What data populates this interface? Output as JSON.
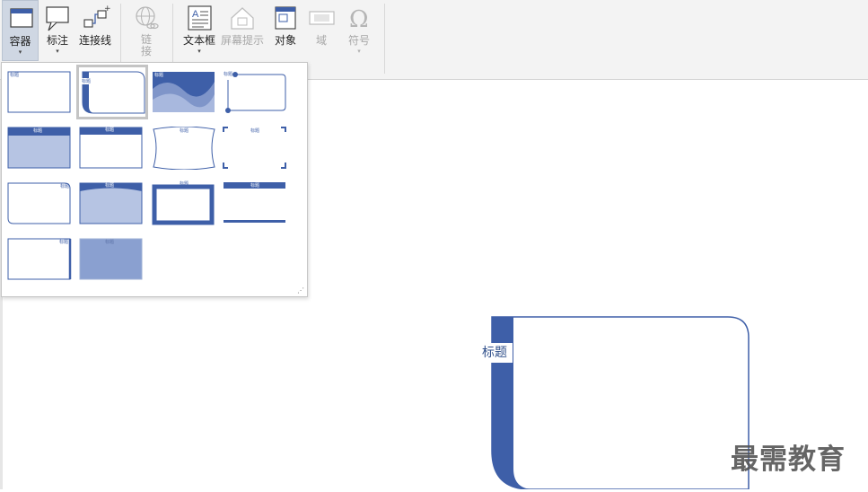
{
  "ribbon": {
    "buttons": [
      {
        "id": "container",
        "label": "容器",
        "has_arrow": true,
        "disabled": false
      },
      {
        "id": "callout",
        "label": "标注",
        "has_arrow": true,
        "disabled": false
      },
      {
        "id": "connector",
        "label": "连接线",
        "has_arrow": false,
        "disabled": false
      },
      {
        "id": "link",
        "label": "链接",
        "has_arrow": false,
        "disabled": true
      },
      {
        "id": "textbox",
        "label": "文本框",
        "has_arrow": true,
        "disabled": false
      },
      {
        "id": "screentip",
        "label": "屏幕提示",
        "has_arrow": false,
        "disabled": true
      },
      {
        "id": "object",
        "label": "对象",
        "has_arrow": false,
        "disabled": false
      },
      {
        "id": "field",
        "label": "域",
        "has_arrow": false,
        "disabled": true
      },
      {
        "id": "symbol",
        "label": "符号",
        "has_arrow": true,
        "disabled": true
      }
    ],
    "arrow_glyph": "▾"
  },
  "gallery": {
    "tile_title": "标题",
    "selected_index": 1,
    "accent": "#3e5fa8",
    "light_fill": "#b6c4e3"
  },
  "canvas": {
    "container_title": "标题"
  },
  "watermark": "最需教育",
  "colors": {
    "accent": "#3e5fa8",
    "ribbon_bg": "#f3f3f3",
    "selected_btn": "#cfd7e3"
  }
}
